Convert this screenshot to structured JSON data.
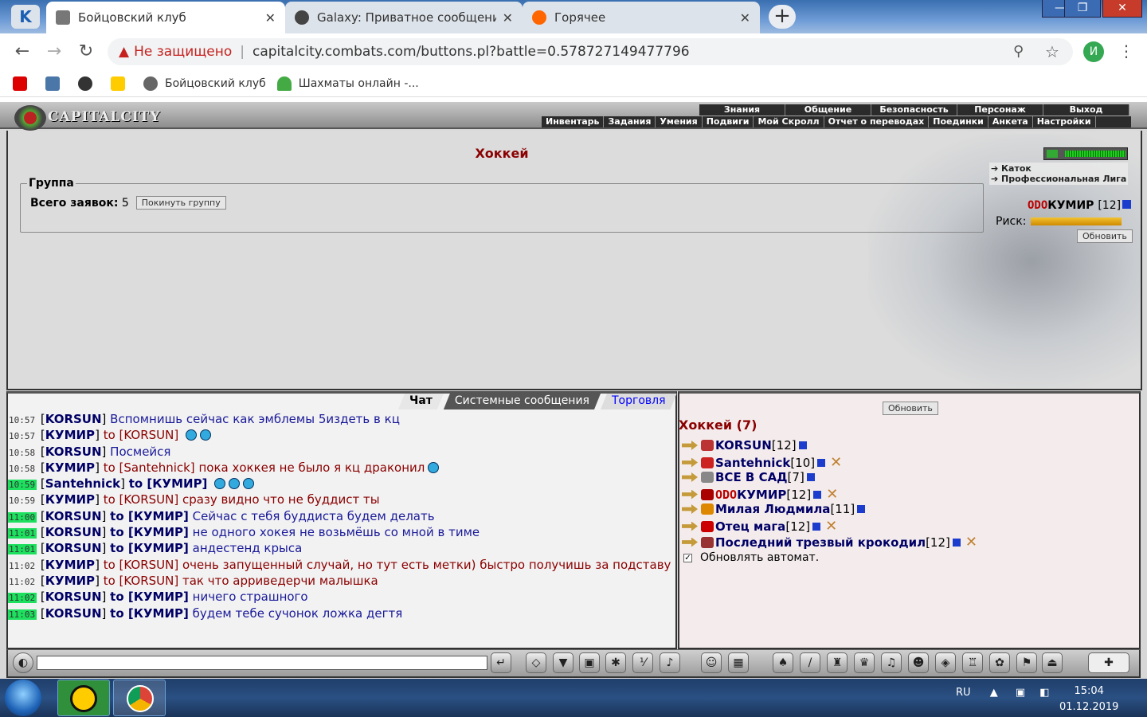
{
  "browser": {
    "tabs": [
      {
        "title": "Бойцовский клуб",
        "active": true
      },
      {
        "title": "Galaxy: Приватное сообщение",
        "active": false
      },
      {
        "title": "Горячее",
        "active": false
      }
    ],
    "new_tab": "+",
    "window_controls": {
      "minimize": "—",
      "maximize": "❐",
      "close": "✕"
    },
    "security_label": "Не защищено",
    "url": "capitalcity.combats.com/buttons.pl?battle=0.578727149477796",
    "profile_initial": "И",
    "bookmarks": [
      {
        "label": ""
      },
      {
        "label": ""
      },
      {
        "label": ""
      },
      {
        "label": ""
      },
      {
        "label": "Бойцовский клуб"
      },
      {
        "label": "Шахматы онлайн -..."
      }
    ]
  },
  "game": {
    "logo": "CAPITALCITY",
    "menu_top": [
      "Знания",
      "Общение",
      "Безопасность",
      "Персонаж",
      "Выход"
    ],
    "menu_bottom": [
      "Инвентарь",
      "Задания",
      "Умения",
      "Подвиги",
      "Мой Скролл",
      "Отчет о переводах",
      "Поединки",
      "Анкета",
      "Настройки"
    ],
    "page_title": "Хоккей",
    "group": {
      "legend": "Группа",
      "count_label": "Всего заявок:",
      "count_value": "5",
      "leave_button": "Покинуть группу"
    },
    "location": [
      "Каток",
      "Профессиональная Лига"
    ],
    "player": {
      "clan": "ODO",
      "name": "КУМИР",
      "level": "[12]"
    },
    "risk_label": "Риск:",
    "refresh_top": "Обновить",
    "chat_tabs": [
      "Чат",
      "Системные сообщения",
      "Торговля"
    ],
    "chat_messages": [
      {
        "time": "10:57",
        "hl": false,
        "who": "KORSUN",
        "to": "",
        "private": false,
        "text": "Вспомнишь сейчас как эмблемы 5издеть в кц",
        "smileys": 0
      },
      {
        "time": "10:57",
        "hl": false,
        "who": "КУМИР",
        "to": "to [KORSUN]",
        "private": false,
        "text": "",
        "smileys": 2
      },
      {
        "time": "10:58",
        "hl": false,
        "who": "KORSUN",
        "to": "",
        "private": false,
        "text": "Посмейся",
        "smileys": 0
      },
      {
        "time": "10:58",
        "hl": false,
        "who": "КУМИР",
        "to": "to [Santehnick]",
        "private": false,
        "text": "пока хоккея не было я кц драконил",
        "smileys": 1
      },
      {
        "time": "10:59",
        "hl": true,
        "who": "Santehnick",
        "to": "to [КУМИР]",
        "private": true,
        "text": "",
        "smileys": 3
      },
      {
        "time": "10:59",
        "hl": false,
        "who": "КУМИР",
        "to": "to [KORSUN]",
        "private": false,
        "text": "сразу видно что не буддист ты",
        "smileys": 0
      },
      {
        "time": "11:00",
        "hl": true,
        "who": "KORSUN",
        "to": "to [КУМИР]",
        "private": true,
        "text": "Сейчас с тебя буддиста будем делать",
        "smileys": 0
      },
      {
        "time": "11:01",
        "hl": true,
        "who": "KORSUN",
        "to": "to [КУМИР]",
        "private": true,
        "text": "не одного хокея не возьмёшь со мной в тиме",
        "smileys": 0
      },
      {
        "time": "11:01",
        "hl": true,
        "who": "KORSUN",
        "to": "to [КУМИР]",
        "private": true,
        "text": "андестенд крыса",
        "smileys": 0
      },
      {
        "time": "11:02",
        "hl": false,
        "who": "КУМИР",
        "to": "to [KORSUN]",
        "private": false,
        "text": "очень запущенный случай, но тут есть метки) быстро получишь за подставу",
        "smileys": 0
      },
      {
        "time": "11:02",
        "hl": false,
        "who": "КУМИР",
        "to": "to [KORSUN]",
        "private": false,
        "text": "так что арриведерчи малышка",
        "smileys": 0
      },
      {
        "time": "11:02",
        "hl": true,
        "who": "KORSUN",
        "to": "to [КУМИР]",
        "private": true,
        "text": "ничего страшного",
        "smileys": 0
      },
      {
        "time": "11:03",
        "hl": true,
        "who": "KORSUN",
        "to": "to [КУМИР]",
        "private": true,
        "text": "будем тебе сучонок ложка дегтя",
        "smileys": 0
      }
    ],
    "players_refresh": "Обновить",
    "players_title": "Хоккей (7)",
    "players": [
      {
        "name": "KORSUN",
        "level": "[12]",
        "x": false,
        "clan": "",
        "icon_color": "#b33"
      },
      {
        "name": "Santehnick",
        "level": "[10]",
        "x": true,
        "clan": "",
        "icon_color": "#c22"
      },
      {
        "name": "ВСЕ В САД",
        "level": "[7]",
        "x": false,
        "clan": "",
        "icon_color": "#888"
      },
      {
        "name": "КУМИР",
        "level": "[12]",
        "x": true,
        "clan": "ODO",
        "icon_color": "#a00"
      },
      {
        "name": "Милая Людмила",
        "level": "[11]",
        "x": false,
        "clan": "",
        "icon_color": "#d80"
      },
      {
        "name": "Отец мага",
        "level": "[12]",
        "x": true,
        "clan": "",
        "icon_color": "#c00"
      },
      {
        "name": "Последний трезвый крокодил",
        "level": "[12]",
        "x": true,
        "clan": "",
        "icon_color": "#933"
      }
    ],
    "auto_refresh_label": "Обновлять автомат.",
    "auto_refresh_checked": true
  },
  "taskbar": {
    "lang": "RU",
    "time": "15:04",
    "date": "01.12.2019"
  }
}
